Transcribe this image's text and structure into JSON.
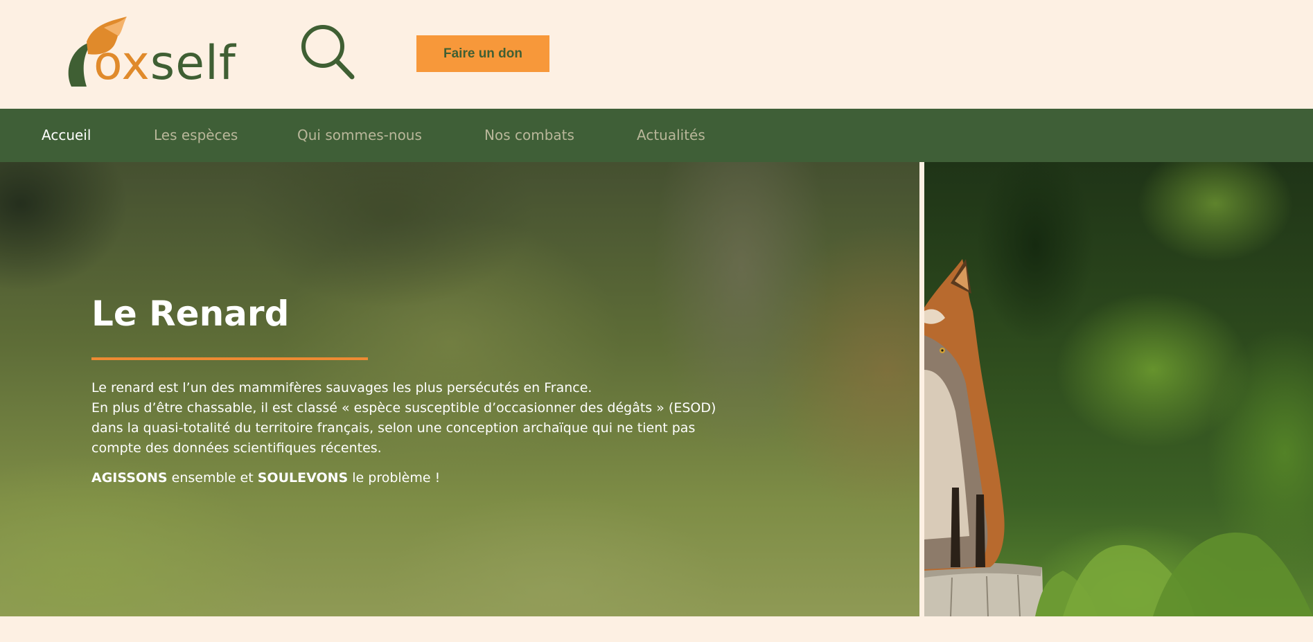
{
  "header": {
    "logo": {
      "text_prefix": "f",
      "text_o": "o",
      "text_x": "x",
      "text_rest": "self"
    },
    "search_icon": "search-icon",
    "donate_label": "Faire un don"
  },
  "nav": {
    "items": [
      {
        "label": "Accueil",
        "active": true
      },
      {
        "label": "Les espèces",
        "active": false
      },
      {
        "label": "Qui sommes-nous",
        "active": false
      },
      {
        "label": "Nos combats",
        "active": false
      },
      {
        "label": "Actualités",
        "active": false
      }
    ]
  },
  "hero": {
    "title": "Le Renard",
    "paragraph_line1": "Le renard est l’un des mammifères sauvages les plus persécutés en France.",
    "paragraph_line2": "En plus d’être chassable, il est classé « espèce susceptible d’occasionner des dégâts » (ESOD) dans la quasi-totalité du territoire français, selon une conception archaïque qui ne tient pas compte des données scientifiques récentes.",
    "cta_strong1": "AGISSONS",
    "cta_mid": " ensemble et ",
    "cta_strong2": "SOULEVONS",
    "cta_end": " le problème !"
  },
  "colors": {
    "background": "#fdf0e3",
    "nav": "#3f5f37",
    "accent_orange": "#f7983a",
    "brand_green": "#3f5f33"
  }
}
